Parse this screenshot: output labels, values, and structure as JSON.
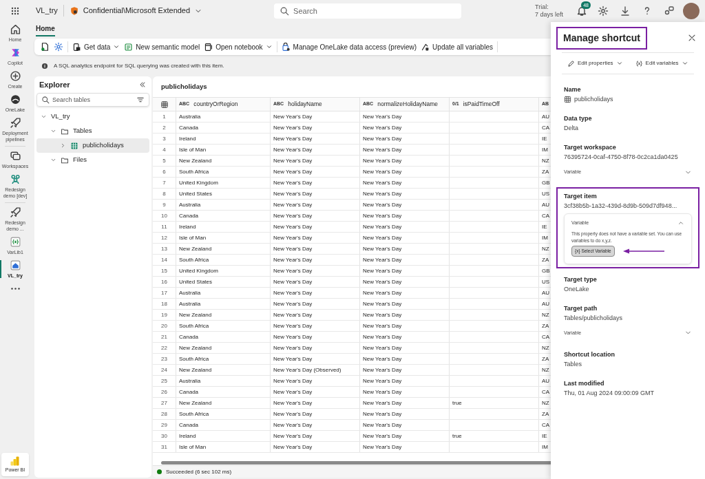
{
  "top_bar": {
    "workspace": "VL_try",
    "sensitivity": "Confidential\\Microsoft Extended",
    "search": {
      "placeholder": "Search"
    },
    "trial": [
      "Trial:",
      "7 days left"
    ],
    "notification_count": "48"
  },
  "rail": [
    {
      "label": "Home",
      "kind": "home",
      "selected": false
    },
    {
      "label": "Copilot",
      "kind": "copilot",
      "selected": false
    },
    {
      "label": "Create",
      "kind": "create",
      "selected": false
    },
    {
      "label": "OneLake",
      "kind": "lake",
      "selected": false
    },
    {
      "label": "Deployment pipelines",
      "kind": "pipeline",
      "selected": false
    },
    {
      "label": "Workspaces",
      "kind": "workspaces",
      "selected": false
    },
    {
      "label": "Redesign demo [dev]",
      "kind": "workspace",
      "selected": false
    },
    {
      "label": "Redesign demo ...",
      "kind": "pipeline",
      "selected": false
    },
    {
      "label": "VarLib1",
      "kind": "library",
      "selected": false
    },
    {
      "label": "VL_try",
      "kind": "lakehouse",
      "selected": true
    },
    {
      "kind": "more",
      "selected": false
    }
  ],
  "rail_footer": "Power BI",
  "tabs": [
    {
      "label": "Home",
      "selected": true
    }
  ],
  "toolbar": [
    {
      "kind": "icon"
    },
    {
      "kind": "icon"
    },
    {
      "kind": "divider"
    },
    {
      "kind": "button",
      "label": "Get data",
      "menu": true
    },
    {
      "kind": "button",
      "label": "New semantic model",
      "menu": false
    },
    {
      "kind": "button",
      "label": "Open notebook",
      "menu": true
    },
    {
      "kind": "divider"
    },
    {
      "kind": "button",
      "label": "Manage OneLake data access (preview)",
      "menu": false
    },
    {
      "kind": "button",
      "label": "Update all variables",
      "menu": false
    },
    {
      "kind": "divider"
    }
  ],
  "info_bar": "A SQL analytics endpoint for SQL querying was created with this item.",
  "explorer": {
    "title": "Explorer",
    "search": {
      "placeholder": "Search tables"
    },
    "tree": [
      {
        "label": "VL_try",
        "expanded": true,
        "selected": false,
        "children": [
          {
            "label": "Tables",
            "kind": "folder",
            "expanded": true,
            "selected": false,
            "children": [
              {
                "label": "publicholidays",
                "kind": "table",
                "expanded": false,
                "selected": true
              }
            ]
          },
          {
            "label": "Files",
            "kind": "folder",
            "expanded": true,
            "selected": false
          }
        ]
      }
    ]
  },
  "table": {
    "title": "publicholidays",
    "columns": [
      {
        "type": "ABC",
        "label": "countryOrRegion"
      },
      {
        "type": "ABC",
        "label": "holidayName"
      },
      {
        "type": "ABC",
        "label": "normalizeHolidayName"
      },
      {
        "type": "0/1",
        "label": "isPaidTimeOff"
      },
      {
        "type": "AB"
      }
    ],
    "rows": [
      {
        "number": "1",
        "cells": [
          "Australia",
          "New Year's Day",
          "New Year's Day",
          null,
          "AU"
        ]
      },
      {
        "number": "2",
        "cells": [
          "Canada",
          "New Year's Day",
          "New Year's Day",
          null,
          "CA"
        ]
      },
      {
        "number": "3",
        "cells": [
          "Ireland",
          "New Year's Day",
          "New Year's Day",
          null,
          "IE"
        ]
      },
      {
        "number": "4",
        "cells": [
          "Isle of Man",
          "New Year's Day",
          "New Year's Day",
          null,
          "IM"
        ]
      },
      {
        "number": "5",
        "cells": [
          "New Zealand",
          "New Year's Day",
          "New Year's Day",
          null,
          "NZ"
        ]
      },
      {
        "number": "6",
        "cells": [
          "South Africa",
          "New Year's Day",
          "New Year's Day",
          null,
          "ZA"
        ]
      },
      {
        "number": "7",
        "cells": [
          "United Kingdom",
          "New Year's Day",
          "New Year's Day",
          null,
          "GB"
        ]
      },
      {
        "number": "8",
        "cells": [
          "United States",
          "New Year's Day",
          "New Year's Day",
          null,
          "US"
        ]
      },
      {
        "number": "9",
        "cells": [
          "Australia",
          "New Year's Day",
          "New Year's Day",
          null,
          "AU"
        ]
      },
      {
        "number": "10",
        "cells": [
          "Canada",
          "New Year's Day",
          "New Year's Day",
          null,
          "CA"
        ]
      },
      {
        "number": "11",
        "cells": [
          "Ireland",
          "New Year's Day",
          "New Year's Day",
          null,
          "IE"
        ]
      },
      {
        "number": "12",
        "cells": [
          "Isle of Man",
          "New Year's Day",
          "New Year's Day",
          null,
          "IM"
        ]
      },
      {
        "number": "13",
        "cells": [
          "New Zealand",
          "New Year's Day",
          "New Year's Day",
          null,
          "NZ"
        ]
      },
      {
        "number": "14",
        "cells": [
          "South Africa",
          "New Year's Day",
          "New Year's Day",
          null,
          "ZA"
        ]
      },
      {
        "number": "15",
        "cells": [
          "United Kingdom",
          "New Year's Day",
          "New Year's Day",
          null,
          "GB"
        ]
      },
      {
        "number": "16",
        "cells": [
          "United States",
          "New Year's Day",
          "New Year's Day",
          null,
          "US"
        ]
      },
      {
        "number": "17",
        "cells": [
          "Australia",
          "New Year's Day",
          "New Year's Day",
          null,
          "AU"
        ]
      },
      {
        "number": "18",
        "cells": [
          "Australia",
          "New Year's Day",
          "New Year's Day",
          null,
          "AU"
        ]
      },
      {
        "number": "19",
        "cells": [
          "New Zealand",
          "New Year's Day",
          "New Year's Day",
          null,
          "NZ"
        ]
      },
      {
        "number": "20",
        "cells": [
          "South Africa",
          "New Year's Day",
          "New Year's Day",
          null,
          "ZA"
        ]
      },
      {
        "number": "21",
        "cells": [
          "Canada",
          "New Year's Day",
          "New Year's Day",
          null,
          "CA"
        ]
      },
      {
        "number": "22",
        "cells": [
          "New Zealand",
          "New Year's Day",
          "New Year's Day",
          null,
          "NZ"
        ]
      },
      {
        "number": "23",
        "cells": [
          "South Africa",
          "New Year's Day",
          "New Year's Day",
          null,
          "ZA"
        ]
      },
      {
        "number": "24",
        "cells": [
          "New Zealand",
          "New Year's Day (Observed)",
          "New Year's Day",
          null,
          "NZ"
        ]
      },
      {
        "number": "25",
        "cells": [
          "Australia",
          "New Year's Day",
          "New Year's Day",
          null,
          "AU"
        ]
      },
      {
        "number": "26",
        "cells": [
          "Canada",
          "New Year's Day",
          "New Year's Day",
          null,
          "CA"
        ]
      },
      {
        "number": "27",
        "cells": [
          "New Zealand",
          "New Year's Day",
          "New Year's Day",
          "true",
          "NZ"
        ]
      },
      {
        "number": "28",
        "cells": [
          "South Africa",
          "New Year's Day",
          "New Year's Day",
          null,
          "ZA"
        ]
      },
      {
        "number": "29",
        "cells": [
          "Canada",
          "New Year's Day",
          "New Year's Day",
          null,
          "CA"
        ]
      },
      {
        "number": "30",
        "cells": [
          "Ireland",
          "New Year's Day",
          "New Year's Day",
          "true",
          "IE"
        ]
      },
      {
        "number": "31",
        "cells": [
          "Isle of Man",
          "New Year's Day",
          "New Year's Day",
          null,
          "IM"
        ]
      }
    ]
  },
  "status_bar": "Succeeded (6 sec 102 ms)",
  "panel": {
    "title": "Manage shortcut",
    "title_highlighted": true,
    "actions": [
      {
        "kind": "edit",
        "label": "Edit properties"
      },
      {
        "kind": "variables",
        "label": "Edit variables"
      }
    ],
    "fields": [
      {
        "label": "Name",
        "value": "publicholidays",
        "kind": "table",
        "highlighted": false
      },
      {
        "label": "Data type",
        "value": "Delta",
        "highlighted": false
      },
      {
        "label": "Target workspace",
        "value": "76395724-0caf-4750-8f78-0c2ca1da0425",
        "variable": {
          "label": "Variable",
          "expanded": false
        },
        "highlighted": false
      },
      {
        "label": "Target item",
        "value": "3cf38b5b-1a32-439d-8d9b-509d7df948...",
        "variable": {
          "label": "Variable",
          "expanded": true,
          "message": "This property does not have a variable set. You can use variables to do x,y,z.",
          "button": "{x} Select Variable"
        },
        "highlighted": true
      },
      {
        "label": "Target type",
        "value": "OneLake",
        "highlighted": false
      },
      {
        "label": "Target path",
        "value": "Tables/publicholidays",
        "variable": {
          "label": "Variable",
          "expanded": false
        },
        "highlighted": false
      },
      {
        "label": "Shortcut location",
        "value": "Tables",
        "highlighted": false
      },
      {
        "label": "Last modified",
        "value": "Thu, 01 Aug 2024 09:00:09 GMT",
        "highlighted": false
      }
    ]
  }
}
